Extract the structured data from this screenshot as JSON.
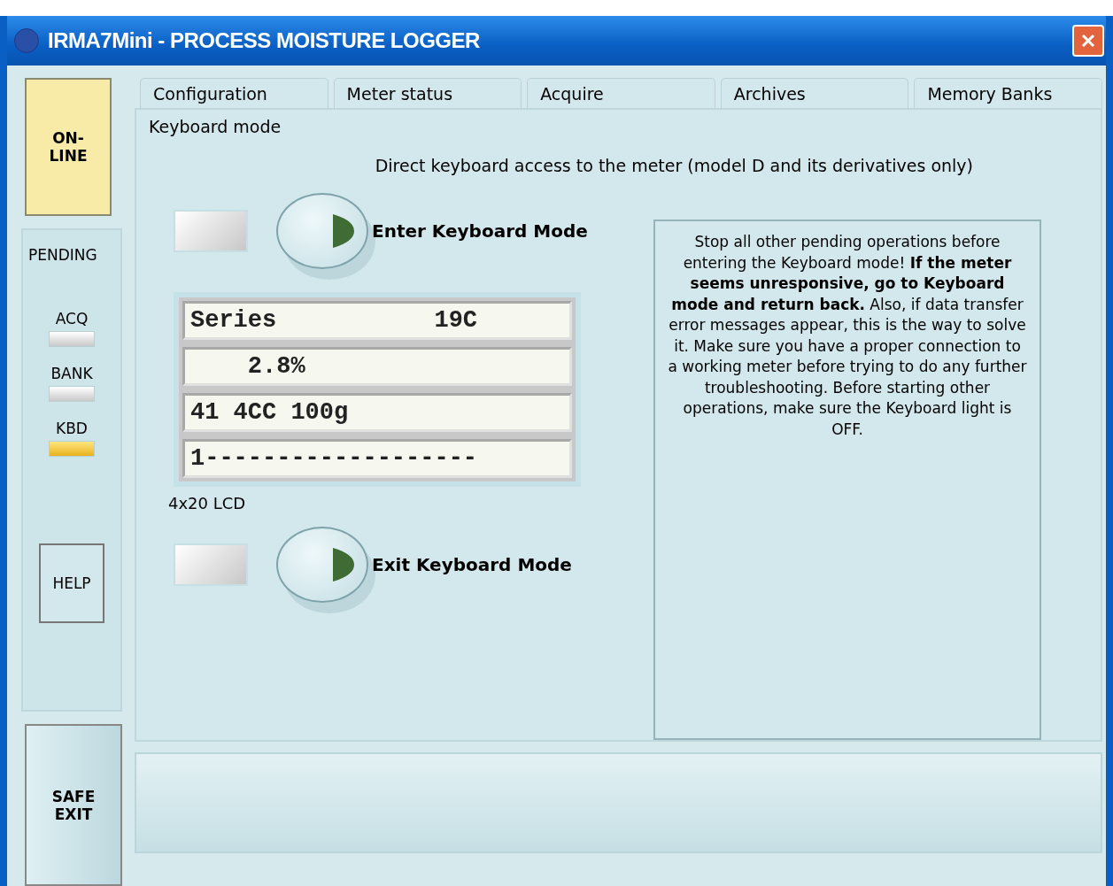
{
  "window": {
    "title": "IRMA7Mini - PROCESS MOISTURE LOGGER"
  },
  "sidebar": {
    "online_button": "ON-\nLINE",
    "pending_label": "PENDING",
    "lamps": [
      {
        "label": "ACQ",
        "on": false
      },
      {
        "label": "BANK",
        "on": false
      },
      {
        "label": "KBD",
        "on": true
      }
    ],
    "help_button": "HELP",
    "safe_exit_button": "SAFE\nEXIT"
  },
  "tabs": [
    {
      "label": "Configuration"
    },
    {
      "label": "Meter status"
    },
    {
      "label": "Acquire"
    },
    {
      "label": "Archives"
    },
    {
      "label": "Memory Banks"
    }
  ],
  "panel": {
    "title": "Keyboard mode",
    "heading": "Direct keyboard access to the meter (model D and its derivatives only)",
    "enter": {
      "label": "Enter Keyboard Mode",
      "on": false
    },
    "lcd": {
      "lines": [
        "Series           19C",
        "    2.8%",
        "41 4CC 100g",
        "1-------------------"
      ],
      "caption": "4x20 LCD"
    },
    "exit": {
      "label": "Exit Keyboard Mode",
      "on": false
    },
    "note": "Stop all other pending operations before entering the Keyboard mode! **If the meter seems unresponsive, go to Keyboard mode and return back.** Also, if data transfer error messages appear, this is the way to solve it. Make sure you have a proper connection to a working meter before trying to do any further troubleshooting. Before starting other operations, make sure the Keyboard light is OFF."
  }
}
